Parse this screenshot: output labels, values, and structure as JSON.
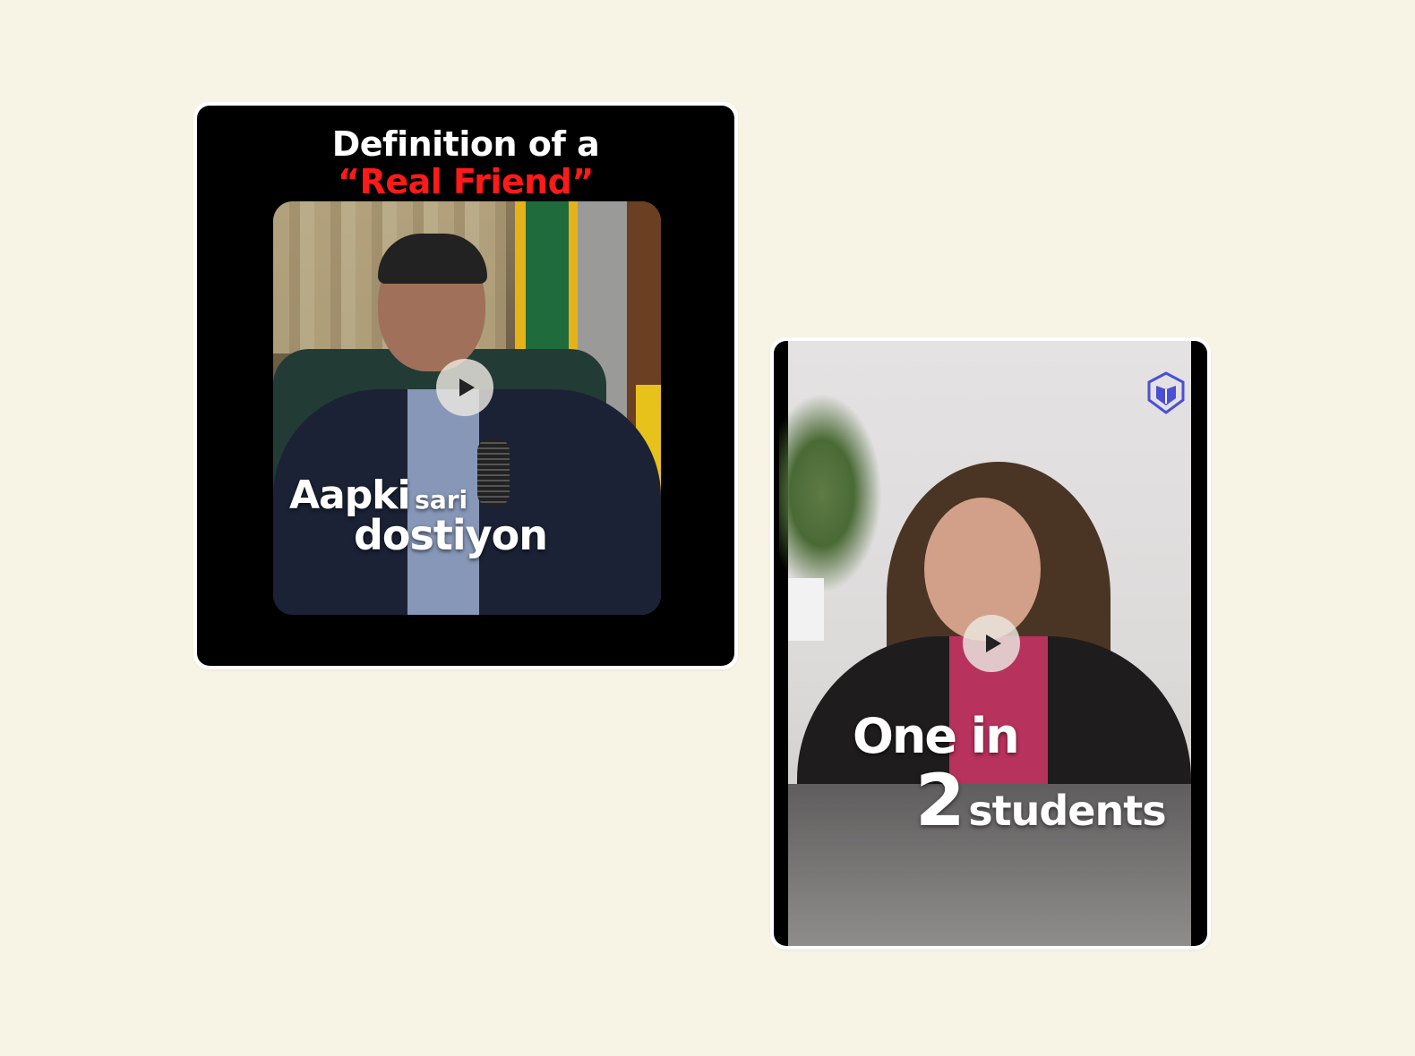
{
  "cards": [
    {
      "title_line1": "Definition of a",
      "title_line2": "“Real Friend”",
      "caption_big": "Aapki",
      "caption_small": "sari",
      "caption_line2": "dostiyon"
    },
    {
      "caption_line1": "One in",
      "caption_number": "2",
      "caption_word": "students"
    }
  ],
  "colors": {
    "page_background": "#f7f4e5",
    "highlight_red": "#ff1a1a",
    "logo_blue": "#4a4fd6"
  },
  "icons": [
    "play-icon",
    "brand-shield-logo-icon"
  ]
}
